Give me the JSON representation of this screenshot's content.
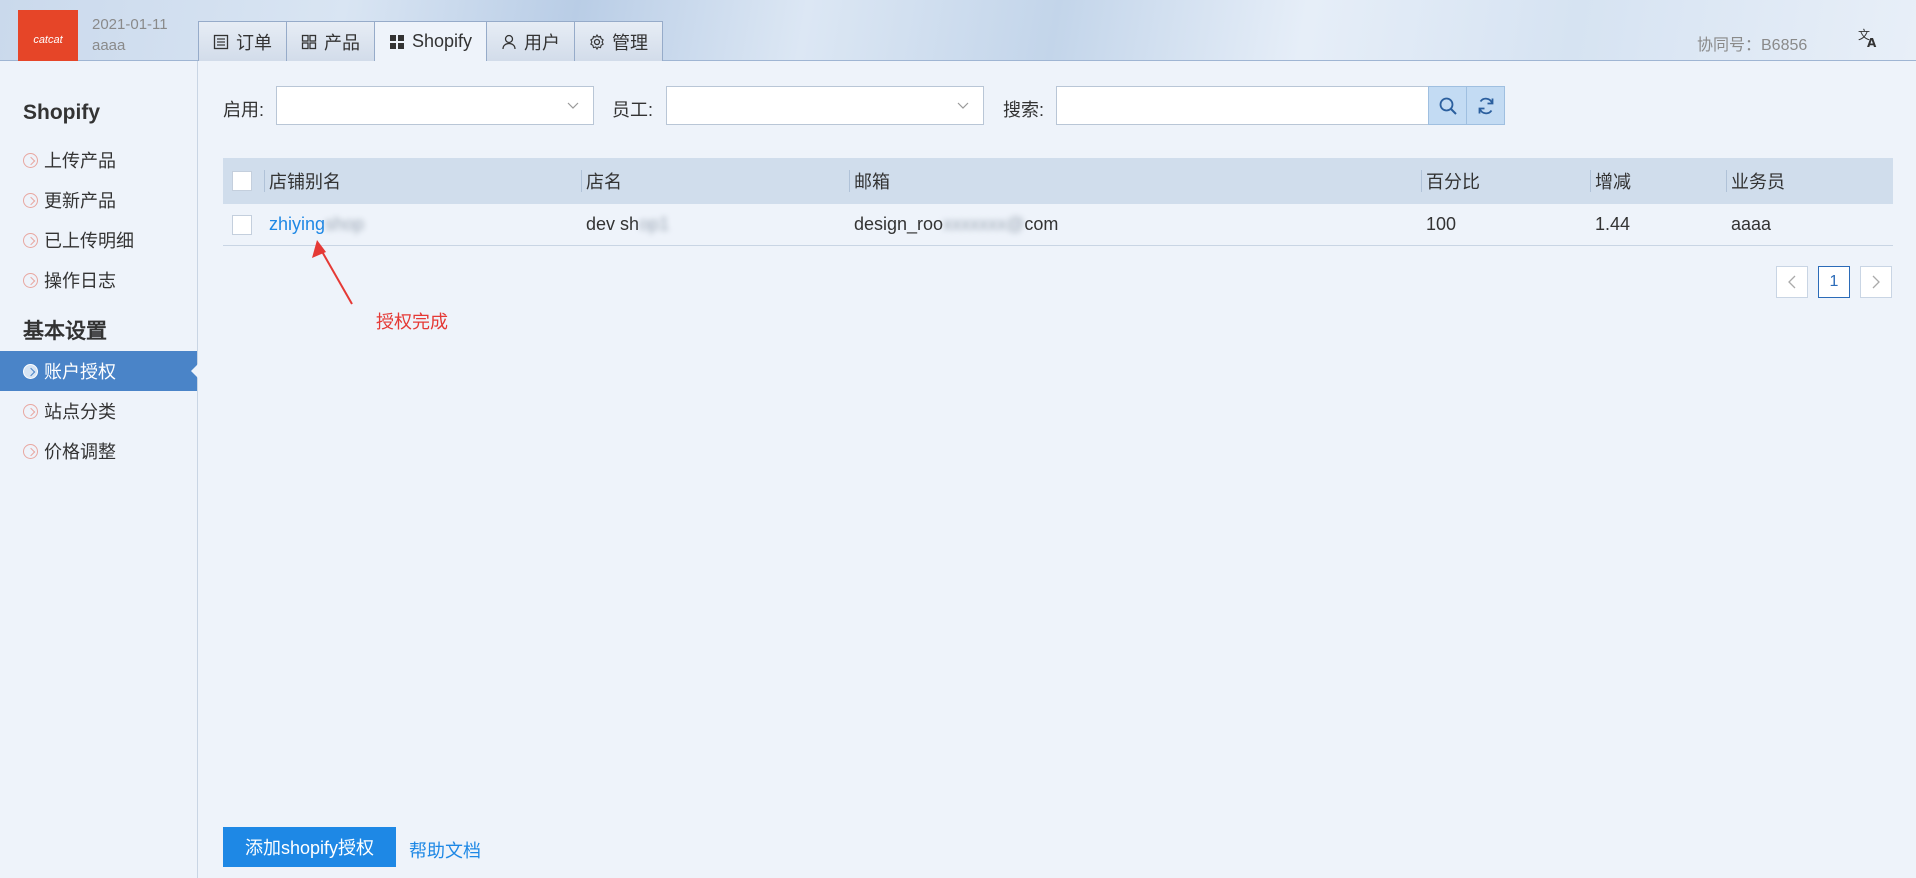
{
  "header": {
    "logo_text": "catcat",
    "date": "2021-01-11",
    "user": "aaaa",
    "tabs": [
      {
        "label": "订单",
        "icon": "list-icon"
      },
      {
        "label": "产品",
        "icon": "grid-icon"
      },
      {
        "label": "Shopify",
        "icon": "apps-icon"
      },
      {
        "label": "用户",
        "icon": "user-icon"
      },
      {
        "label": "管理",
        "icon": "gear-icon"
      }
    ],
    "active_tab": "Shopify",
    "contract": "协同号：B6856",
    "translate_icon": "translate-icon"
  },
  "sidebar": {
    "groups": [
      {
        "title": "Shopify",
        "items": [
          {
            "label": "上传产品"
          },
          {
            "label": "更新产品"
          },
          {
            "label": "已上传明细"
          },
          {
            "label": "操作日志"
          }
        ]
      },
      {
        "title": "基本设置",
        "items": [
          {
            "label": "账户授权"
          },
          {
            "label": "站点分类"
          },
          {
            "label": "价格调整"
          }
        ]
      }
    ],
    "active_item": "账户授权"
  },
  "filters": {
    "enabled_label": "启用:",
    "enabled_value": "",
    "staff_label": "员工:",
    "staff_value": "",
    "search_label": "搜索:",
    "search_value": ""
  },
  "table": {
    "columns": [
      "店铺别名",
      "店名",
      "邮箱",
      "百分比",
      "增减",
      "业务员"
    ],
    "rows": [
      {
        "alias_visible": "zhiying",
        "alias_blurred": " shop",
        "shop_visible": "dev sh",
        "shop_blurred": "op1",
        "email_visible_start": "design_roo",
        "email_blurred": "xxxxxxx@",
        "email_visible_end": "com",
        "percent": "100",
        "adjust": "1.44",
        "salesperson": "aaaa"
      }
    ]
  },
  "pagination": {
    "prev": "<",
    "current": "1",
    "next": ">"
  },
  "annotation": {
    "text": "授权完成",
    "color": "#e53935"
  },
  "footer": {
    "add_button": "添加shopify授权",
    "help_link": "帮助文档"
  },
  "colors": {
    "accent": "#4a84c8",
    "primary_button": "#1e88e5",
    "logo": "#e64528"
  }
}
